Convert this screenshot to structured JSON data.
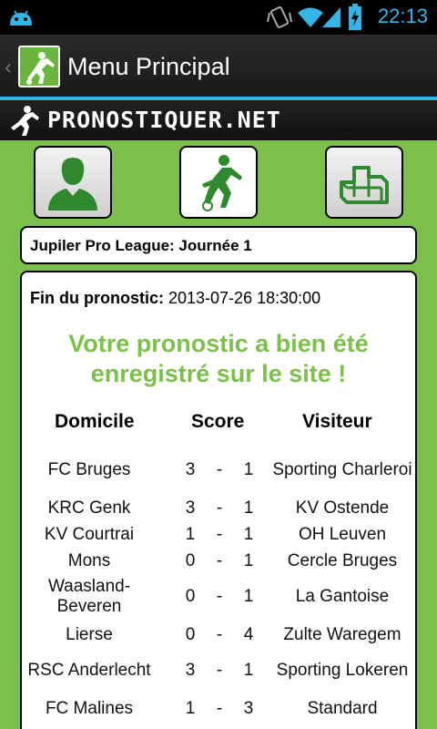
{
  "status_bar": {
    "time": "22:13",
    "icons": [
      "android-debug-icon",
      "vibrate-icon",
      "wifi-icon",
      "signal-icon",
      "battery-charging-icon"
    ]
  },
  "action_bar": {
    "title": "Menu Principal"
  },
  "brand": {
    "name": "PRONOSTIQUER.NET"
  },
  "nav": [
    {
      "icon": "profile-silhouette-icon",
      "active": false
    },
    {
      "icon": "football-player-icon",
      "active": true
    },
    {
      "icon": "podium-icon",
      "active": false
    }
  ],
  "league": {
    "title": "Jupiler Pro League: Journée 1"
  },
  "prediction": {
    "deadline_label": "Fin du pronostic:",
    "deadline_value": "2013-07-26 18:30:00",
    "confirmation": "Votre pronostic a bien été enregistré sur le site !",
    "headers": {
      "home": "Domicile",
      "score": "Score",
      "away": "Visiteur"
    },
    "matches": [
      {
        "home": "FC Bruges",
        "home_goals": "3",
        "sep": "-",
        "away_goals": "1",
        "away": "Sporting Charleroi"
      },
      {
        "home": "KRC Genk",
        "home_goals": "3",
        "sep": "-",
        "away_goals": "1",
        "away": "KV Ostende"
      },
      {
        "home": "KV Courtrai",
        "home_goals": "1",
        "sep": "-",
        "away_goals": "1",
        "away": "OH Leuven"
      },
      {
        "home": "Mons",
        "home_goals": "0",
        "sep": "-",
        "away_goals": "1",
        "away": "Cercle Bruges"
      },
      {
        "home": "Waasland-Beveren",
        "home_goals": "0",
        "sep": "-",
        "away_goals": "1",
        "away": "La Gantoise"
      },
      {
        "home": "Lierse",
        "home_goals": "0",
        "sep": "-",
        "away_goals": "4",
        "away": "Zulte Waregem"
      },
      {
        "home": "RSC Anderlecht",
        "home_goals": "3",
        "sep": "-",
        "away_goals": "1",
        "away": "Sporting Lokeren"
      },
      {
        "home": "FC Malines",
        "home_goals": "1",
        "sep": "-",
        "away_goals": "3",
        "away": "Standard"
      }
    ]
  },
  "colors": {
    "background": "#7cc04a",
    "accent": "#33b5e5",
    "confirmation": "#7cc04a",
    "icon_green": "#2f8a2f"
  }
}
